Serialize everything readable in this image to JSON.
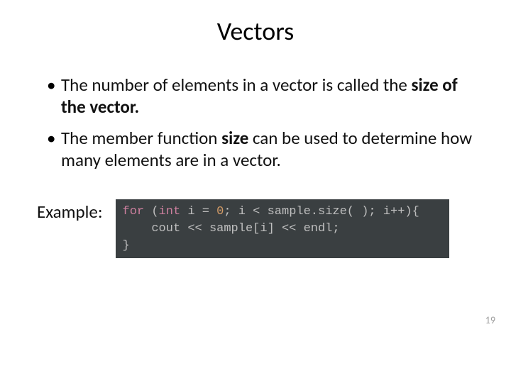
{
  "title": "Vectors",
  "bullets": [
    {
      "pre": "The number of elements in a vector is called the ",
      "bold": "size of the vector.",
      "post": ""
    },
    {
      "pre": "The member function ",
      "bold": "size",
      "post": " can be used to determine how many elements are in a vector."
    }
  ],
  "example_label": "Example:",
  "code": {
    "kw_for": "for",
    "open_paren": " (",
    "kw_int": "int",
    "loop_decl": " i = ",
    "zero": "0",
    "cond": "; i < sample.size( ); i++){",
    "line2_indent": "    ",
    "line2_body": "cout << sample[i] << endl;",
    "line3": "}"
  },
  "page_number": "19"
}
